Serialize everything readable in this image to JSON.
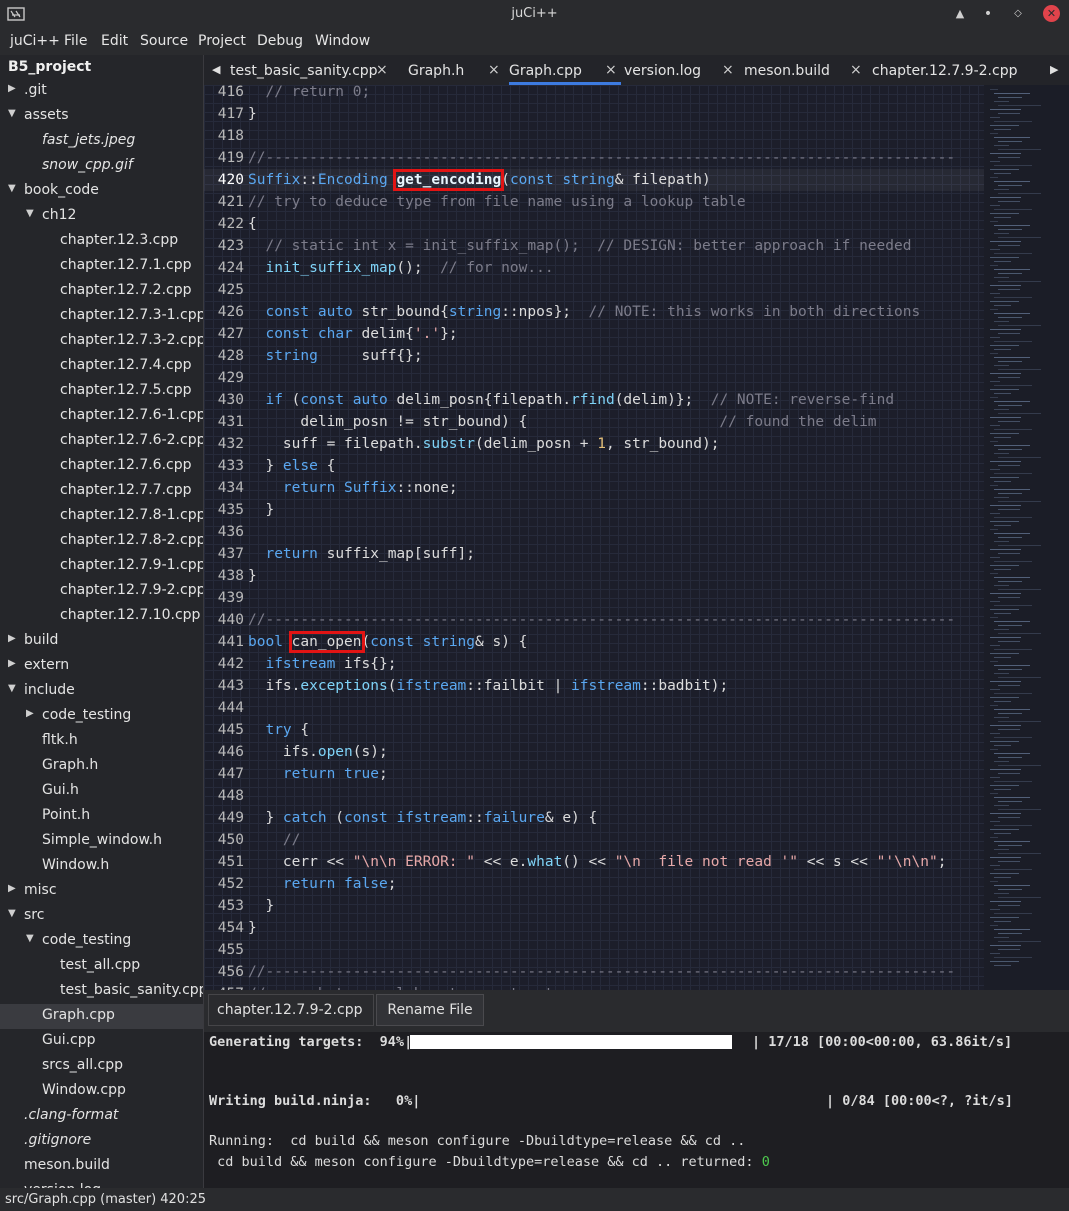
{
  "window": {
    "title": "juCi++"
  },
  "menu": [
    "juCi++",
    "File",
    "Edit",
    "Source",
    "Project",
    "Debug",
    "Window"
  ],
  "sidebar": {
    "project": "B5_project",
    "items": [
      {
        "label": ".git",
        "arrow": "right"
      },
      {
        "label": "assets",
        "arrow": "down"
      },
      {
        "label": "fast_jets.jpeg",
        "italic": true
      },
      {
        "label": "snow_cpp.gif",
        "italic": true
      },
      {
        "label": "book_code",
        "arrow": "down"
      },
      {
        "label": "ch12",
        "arrow": "down"
      },
      {
        "label": "chapter.12.3.cpp"
      },
      {
        "label": "chapter.12.7.1.cpp"
      },
      {
        "label": "chapter.12.7.2.cpp"
      },
      {
        "label": "chapter.12.7.3-1.cpp"
      },
      {
        "label": "chapter.12.7.3-2.cpp"
      },
      {
        "label": "chapter.12.7.4.cpp"
      },
      {
        "label": "chapter.12.7.5.cpp"
      },
      {
        "label": "chapter.12.7.6-1.cpp"
      },
      {
        "label": "chapter.12.7.6-2.cpp"
      },
      {
        "label": "chapter.12.7.6.cpp"
      },
      {
        "label": "chapter.12.7.7.cpp"
      },
      {
        "label": "chapter.12.7.8-1.cpp"
      },
      {
        "label": "chapter.12.7.8-2.cpp"
      },
      {
        "label": "chapter.12.7.9-1.cpp"
      },
      {
        "label": "chapter.12.7.9-2.cpp"
      },
      {
        "label": "chapter.12.7.10.cpp"
      },
      {
        "label": "build",
        "arrow": "right"
      },
      {
        "label": "extern",
        "arrow": "right"
      },
      {
        "label": "include",
        "arrow": "down"
      },
      {
        "label": "code_testing",
        "arrow": "right"
      },
      {
        "label": "fltk.h"
      },
      {
        "label": "Graph.h"
      },
      {
        "label": "Gui.h"
      },
      {
        "label": "Point.h"
      },
      {
        "label": "Simple_window.h"
      },
      {
        "label": "Window.h"
      },
      {
        "label": "misc",
        "arrow": "right"
      },
      {
        "label": "src",
        "arrow": "down"
      },
      {
        "label": "code_testing",
        "arrow": "down"
      },
      {
        "label": "test_all.cpp"
      },
      {
        "label": "test_basic_sanity.cpp"
      },
      {
        "label": "Graph.cpp",
        "selected": true
      },
      {
        "label": "Gui.cpp"
      },
      {
        "label": "srcs_all.cpp"
      },
      {
        "label": "Window.cpp"
      },
      {
        "label": ".clang-format",
        "italic": true
      },
      {
        "label": ".gitignore",
        "italic": true
      },
      {
        "label": "meson.build"
      },
      {
        "label": "version.log"
      }
    ]
  },
  "tabs": [
    {
      "label": "test_basic_sanity.cpp",
      "close": "×"
    },
    {
      "label": "Graph.h",
      "close": "×"
    },
    {
      "label": "Graph.cpp",
      "close": "×",
      "active": true
    },
    {
      "label": "version.log",
      "close": "×"
    },
    {
      "label": "meson.build",
      "close": "×"
    },
    {
      "label": "chapter.12.7.9-2.cpp",
      "close": ""
    }
  ],
  "editor": {
    "lines": [
      {
        "n": "416",
        "html": "<span class=\"cm\">  // return 0;</span>"
      },
      {
        "n": "417",
        "html": "}"
      },
      {
        "n": "418",
        "html": ""
      },
      {
        "n": "419",
        "html": "<span class=\"cm\">//-------------------------------------------------------------------------------</span>"
      },
      {
        "n": "420",
        "html": "<span class=\"ty\">Suffix</span>::<span class=\"ty\">Encoding</span> <span class=\"fn bold hl\" data-name=\"highlight-get-encoding\">get_encoding</span>(<span class=\"kw\">const</span> <span class=\"ty\">string</span>&amp; filepath)",
        "current": true
      },
      {
        "n": "421",
        "html": "<span class=\"cm\">// try to deduce type from file name using a lookup table</span>"
      },
      {
        "n": "422",
        "html": "{"
      },
      {
        "n": "423",
        "html": "<span class=\"cm\">  // static int x = init_suffix_map();  // DESIGN: better approach if needed</span>"
      },
      {
        "n": "424",
        "html": "  <span class=\"fn\">init_suffix_map</span>();  <span class=\"cm\">// for now...</span>"
      },
      {
        "n": "425",
        "html": ""
      },
      {
        "n": "426",
        "html": "  <span class=\"kw\">const</span> <span class=\"kw\">auto</span> str_bound{<span class=\"ty\">string</span>::npos};  <span class=\"cm\">// NOTE: this works in both directions</span>"
      },
      {
        "n": "427",
        "html": "  <span class=\"kw\">const</span> <span class=\"kw\">char</span> delim{<span class=\"st\">'.'</span>};"
      },
      {
        "n": "428",
        "html": "  <span class=\"ty\">string</span>     suff{};"
      },
      {
        "n": "429",
        "html": ""
      },
      {
        "n": "430",
        "html": "  <span class=\"kw\">if</span> (<span class=\"kw\">const</span> <span class=\"kw\">auto</span> delim_posn{filepath.<span class=\"fn\">rfind</span>(delim)};  <span class=\"cm\">// NOTE: reverse-find</span>"
      },
      {
        "n": "431",
        "html": "      delim_posn != str_bound) {                      <span class=\"cm\">// found the delim</span>"
      },
      {
        "n": "432",
        "html": "    suff = filepath.<span class=\"fn\">substr</span>(delim_posn + <span class=\"nm\">1</span>, str_bound);"
      },
      {
        "n": "433",
        "html": "  } <span class=\"kw\">else</span> {"
      },
      {
        "n": "434",
        "html": "    <span class=\"kw\">return</span> <span class=\"ty\">Suffix</span>::none;"
      },
      {
        "n": "435",
        "html": "  }"
      },
      {
        "n": "436",
        "html": ""
      },
      {
        "n": "437",
        "html": "  <span class=\"kw\">return</span> suffix_map[suff];"
      },
      {
        "n": "438",
        "html": "}"
      },
      {
        "n": "439",
        "html": ""
      },
      {
        "n": "440",
        "html": "<span class=\"cm\">//-------------------------------------------------------------------------------</span>"
      },
      {
        "n": "441",
        "html": "<span class=\"kw\">bool</span> <span class=\"hl\" data-name=\"highlight-can-open\">can_open</span>(<span class=\"kw\">const</span> <span class=\"ty\">string</span>&amp; s) {"
      },
      {
        "n": "442",
        "html": "  <span class=\"ty\">ifstream</span> ifs{};"
      },
      {
        "n": "443",
        "html": "  ifs.<span class=\"fn\">exceptions</span>(<span class=\"ty\">ifstream</span>::failbit | <span class=\"ty\">ifstream</span>::badbit);"
      },
      {
        "n": "444",
        "html": ""
      },
      {
        "n": "445",
        "html": "  <span class=\"kw\">try</span> {"
      },
      {
        "n": "446",
        "html": "    ifs.<span class=\"fn\">open</span>(s);"
      },
      {
        "n": "447",
        "html": "    <span class=\"kw\">return</span> <span class=\"kw\">true</span>;"
      },
      {
        "n": "448",
        "html": ""
      },
      {
        "n": "449",
        "html": "  } <span class=\"kw\">catch</span> (<span class=\"kw\">const</span> <span class=\"ty\">ifstream</span>::<span class=\"ty\">failure</span>&amp; e) {"
      },
      {
        "n": "450",
        "html": "<span class=\"cm\">    //</span>"
      },
      {
        "n": "451",
        "html": "    cerr &lt;&lt; <span class=\"st\">\"\\n\\n ERROR: \"</span> &lt;&lt; e.<span class=\"fn\">what</span>() &lt;&lt; <span class=\"st\">\"\\n  file not read '\"</span> &lt;&lt; s &lt;&lt; <span class=\"st\">\"'\\n\\n\"</span>;"
      },
      {
        "n": "452",
        "html": "    <span class=\"kw\">return</span> <span class=\"kw\">false</span>;"
      },
      {
        "n": "453",
        "html": "  }"
      },
      {
        "n": "454",
        "html": "}"
      },
      {
        "n": "455",
        "html": ""
      },
      {
        "n": "456",
        "html": "<span class=\"cm\">//-------------------------------------------------------------------------------</span>"
      },
      {
        "n": "457",
        "html": "<span class=\"cm\">// somewhat overelaborate constructor</span>"
      }
    ]
  },
  "rename": {
    "filename": "chapter.12.7.9-2.cpp",
    "button": "Rename File"
  },
  "terminal": {
    "gen_label": "Generating targets:  94%|",
    "gen_progress": 0.94,
    "gen_right": "| 17/18 [00:00<00:00, 63.86it/s]",
    "ninja_label": "Writing build.ninja:   0%|",
    "ninja_right": "| 0/84 [00:00<?, ?it/s]",
    "running": "Running:  cd build && meson configure -Dbuildtype=release && cd ..",
    "returned_prefix": " cd build && meson configure -Dbuildtype=release && cd .. returned: ",
    "returned_code": "0"
  },
  "status": {
    "text": "src/Graph.cpp (master) 420:25"
  },
  "colors": {
    "accent": "#3d7be0",
    "highlight_box": "#e21414",
    "success": "#4ec94e"
  }
}
